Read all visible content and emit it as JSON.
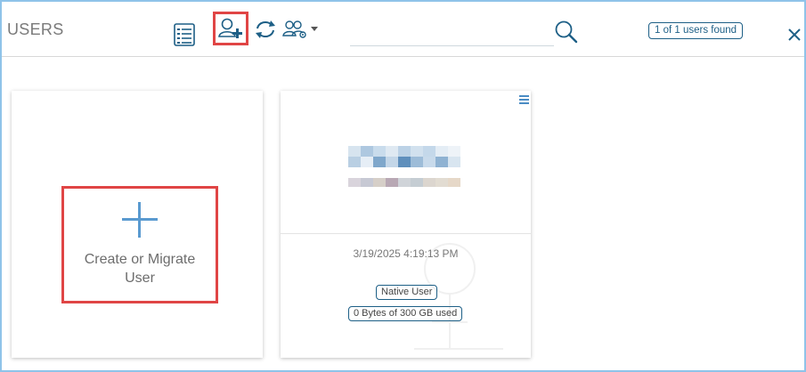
{
  "header": {
    "title": "USERS",
    "search_placeholder": "",
    "found_badge": "1 of 1 users found"
  },
  "toolbar": {
    "icons": [
      "list-view-icon",
      "add-user-icon",
      "sync-icon",
      "user-groups-icon",
      "caret-down-icon",
      "search-icon",
      "close-icon"
    ]
  },
  "create_card": {
    "label": "Create or Migrate User"
  },
  "user_card": {
    "timestamp": "3/19/2025 4:19:13 PM",
    "type_badge": "Native User",
    "storage_badge": "0 Bytes of 300 GB used"
  },
  "colors": {
    "accent_blue": "#1d5f86",
    "plus_blue": "#5a9ad0",
    "highlight_red": "#e04545",
    "frame_border": "#8fc3e9"
  }
}
